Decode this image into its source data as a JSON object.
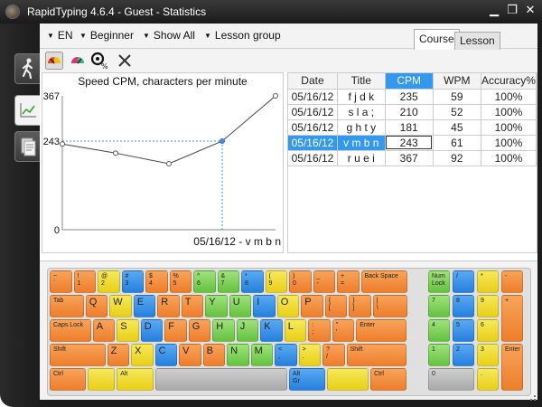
{
  "window": {
    "title": "RapidTyping 4.6.4 - Guest - Statistics",
    "minimize_glyph": "▁",
    "maximize_glyph": "❐",
    "close_glyph": "✕"
  },
  "sidebar": {
    "items": [
      {
        "name": "lesson",
        "icon": "walking-man-icon"
      },
      {
        "name": "statistics",
        "icon": "line-chart-icon",
        "active": true
      },
      {
        "name": "report",
        "icon": "report-document-icon"
      }
    ]
  },
  "toolbar": {
    "language": "EN",
    "level": "Beginner",
    "filter": "Show All",
    "group": "Lesson group",
    "tabs": [
      "Course",
      "Lesson"
    ],
    "active_tab": "Course"
  },
  "icon_toolbar": [
    "speed-chart-icon",
    "accuracy-chart-icon",
    "target-percent-icon",
    "clear-icon"
  ],
  "colors": {
    "selection": "#3399ee",
    "orange": "#ee7d2b",
    "yellow": "#e8cf16",
    "green": "#64c23f",
    "blue": "#2580de",
    "gray": "#a9a9a9"
  },
  "chart_data": {
    "type": "line",
    "title": "Speed CPM, characters per minute",
    "x": [
      "05/16/12 f j d k",
      "05/16/12 s l a ;",
      "05/16/12 g h t y",
      "05/16/12 v m b n",
      "05/16/12 r u e i"
    ],
    "values": [
      235,
      210,
      181,
      243,
      367
    ],
    "ylim": [
      0,
      367
    ],
    "y_ticks": [
      "367",
      "243",
      "0"
    ],
    "highlight_index": 3,
    "highlight_label": "05/16/12 - v m b n"
  },
  "table": {
    "columns": [
      "Date",
      "Title",
      "CPM",
      "WPM",
      "Accuracy%"
    ],
    "selected_column": 2,
    "selected_row": 3,
    "rows": [
      [
        "05/16/12",
        "f j d k",
        "235",
        "59",
        "100%"
      ],
      [
        "05/16/12",
        "s l a ;",
        "210",
        "52",
        "100%"
      ],
      [
        "05/16/12",
        "g h t y",
        "181",
        "45",
        "100%"
      ],
      [
        "05/16/12",
        "v m b n",
        "243",
        "61",
        "100%"
      ],
      [
        "05/16/12",
        "r u e i",
        "367",
        "92",
        "100%"
      ]
    ]
  },
  "keyboard": {
    "rows": [
      [
        {
          "l": "~\n`",
          "c": "orange"
        },
        {
          "l": "!\n1",
          "c": "orange"
        },
        {
          "l": "@\n2",
          "c": "yellow"
        },
        {
          "l": "#\n3",
          "c": "blue"
        },
        {
          "l": "$\n4",
          "c": "orange"
        },
        {
          "l": "%\n5",
          "c": "orange"
        },
        {
          "l": "^\n6",
          "c": "green"
        },
        {
          "l": "&\n7",
          "c": "green"
        },
        {
          "l": "*\n8",
          "c": "blue"
        },
        {
          "l": "(\n9",
          "c": "yellow"
        },
        {
          "l": ")\n0",
          "c": "orange"
        },
        {
          "l": "_\n-",
          "c": "orange"
        },
        {
          "l": "+\n=",
          "c": "orange"
        },
        {
          "l": "Back Space",
          "c": "orange"
        }
      ],
      [
        {
          "l": "Tab",
          "c": "orange"
        },
        {
          "l": "Q",
          "c": "orange",
          "big": true
        },
        {
          "l": "W",
          "c": "yellow",
          "big": true
        },
        {
          "l": "E",
          "c": "blue",
          "big": true
        },
        {
          "l": "R",
          "c": "orange",
          "big": true
        },
        {
          "l": "T",
          "c": "orange",
          "big": true
        },
        {
          "l": "Y",
          "c": "green",
          "big": true
        },
        {
          "l": "U",
          "c": "green",
          "big": true
        },
        {
          "l": "I",
          "c": "blue",
          "big": true
        },
        {
          "l": "O",
          "c": "yellow",
          "big": true
        },
        {
          "l": "P",
          "c": "orange",
          "big": true
        },
        {
          "l": "{\n[",
          "c": "orange"
        },
        {
          "l": "}\n]",
          "c": "orange"
        },
        {
          "l": "|\n\\",
          "c": "orange"
        }
      ],
      [
        {
          "l": "Caps Lock",
          "c": "orange"
        },
        {
          "l": "A",
          "c": "orange",
          "big": true
        },
        {
          "l": "S",
          "c": "yellow",
          "big": true
        },
        {
          "l": "D",
          "c": "blue",
          "big": true
        },
        {
          "l": "F",
          "c": "orange",
          "big": true
        },
        {
          "l": "G",
          "c": "orange",
          "big": true
        },
        {
          "l": "H",
          "c": "green",
          "big": true
        },
        {
          "l": "J",
          "c": "green",
          "big": true
        },
        {
          "l": "K",
          "c": "blue",
          "big": true
        },
        {
          "l": "L",
          "c": "yellow",
          "big": true
        },
        {
          "l": ":\n;",
          "c": "orange"
        },
        {
          "l": "\"\n'",
          "c": "orange"
        },
        {
          "l": "Enter",
          "c": "orange"
        }
      ],
      [
        {
          "l": "Shift",
          "c": "orange"
        },
        {
          "l": "Z",
          "c": "orange",
          "big": true
        },
        {
          "l": "X",
          "c": "yellow",
          "big": true
        },
        {
          "l": "C",
          "c": "blue",
          "big": true
        },
        {
          "l": "V",
          "c": "orange",
          "big": true
        },
        {
          "l": "B",
          "c": "orange",
          "big": true
        },
        {
          "l": "N",
          "c": "green",
          "big": true
        },
        {
          "l": "M",
          "c": "green",
          "big": true
        },
        {
          "l": "<\n,",
          "c": "blue"
        },
        {
          "l": ">\n.",
          "c": "yellow"
        },
        {
          "l": "?\n/",
          "c": "orange"
        },
        {
          "l": "Shift",
          "c": "orange"
        }
      ],
      [
        {
          "l": "Ctrl",
          "c": "orange"
        },
        {
          "l": "",
          "c": "yellow"
        },
        {
          "l": "Alt",
          "c": "yellow"
        },
        {
          "l": "",
          "c": "gray"
        },
        {
          "l": "Alt\nGr",
          "c": "blue"
        },
        {
          "l": "",
          "c": "yellow"
        },
        {
          "l": "Ctrl",
          "c": "orange"
        }
      ]
    ],
    "numpad": [
      {
        "l": "Num\nLock",
        "c": "green"
      },
      {
        "l": "/",
        "c": "blue"
      },
      {
        "l": "*",
        "c": "yellow"
      },
      {
        "l": "-",
        "c": "orange"
      },
      {
        "l": "7",
        "c": "green"
      },
      {
        "l": "8",
        "c": "blue"
      },
      {
        "l": "9",
        "c": "yellow"
      },
      {
        "l": "+",
        "c": "orange"
      },
      {
        "l": "4",
        "c": "green"
      },
      {
        "l": "5",
        "c": "blue"
      },
      {
        "l": "6",
        "c": "yellow"
      },
      {
        "l": "1",
        "c": "green"
      },
      {
        "l": "2",
        "c": "blue"
      },
      {
        "l": "3",
        "c": "yellow"
      },
      {
        "l": "Enter",
        "c": "orange"
      },
      {
        "l": "0",
        "c": "gray"
      },
      {
        "l": ".",
        "c": "yellow"
      }
    ]
  }
}
